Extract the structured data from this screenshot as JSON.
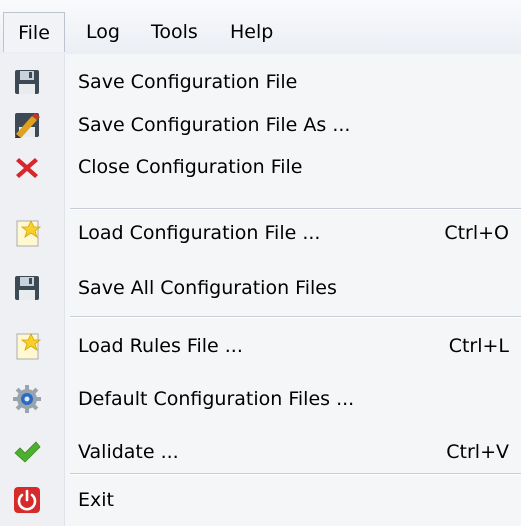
{
  "menubar": {
    "file": "File",
    "log": "Log",
    "tools": "Tools",
    "help": "Help"
  },
  "file_menu": {
    "save_config": {
      "label": "Save Configuration File",
      "icon": "floppy-disk-icon"
    },
    "save_config_as": {
      "label": "Save Configuration File As ...",
      "icon": "floppy-pencil-icon"
    },
    "close_config": {
      "label": "Close Configuration File",
      "icon": "red-x-icon"
    },
    "load_config": {
      "label": "Load Configuration File ...",
      "shortcut": "Ctrl+O",
      "icon": "document-star-icon"
    },
    "save_all": {
      "label": "Save All Configuration Files",
      "icon": "floppy-disk-icon"
    },
    "load_rules": {
      "label": "Load Rules File ...",
      "shortcut": "Ctrl+L",
      "icon": "document-star-icon"
    },
    "default_config": {
      "label": "Default Configuration Files ...",
      "icon": "gear-icon"
    },
    "validate": {
      "label": "Validate ...",
      "shortcut": "Ctrl+V",
      "icon": "green-check-icon"
    },
    "exit": {
      "label": "Exit",
      "icon": "power-icon"
    }
  },
  "colors": {
    "close_red": "#d9262b",
    "check_green": "#4caf2d",
    "exit_red": "#d62b2b",
    "floppy_dark": "#3d4a55"
  }
}
